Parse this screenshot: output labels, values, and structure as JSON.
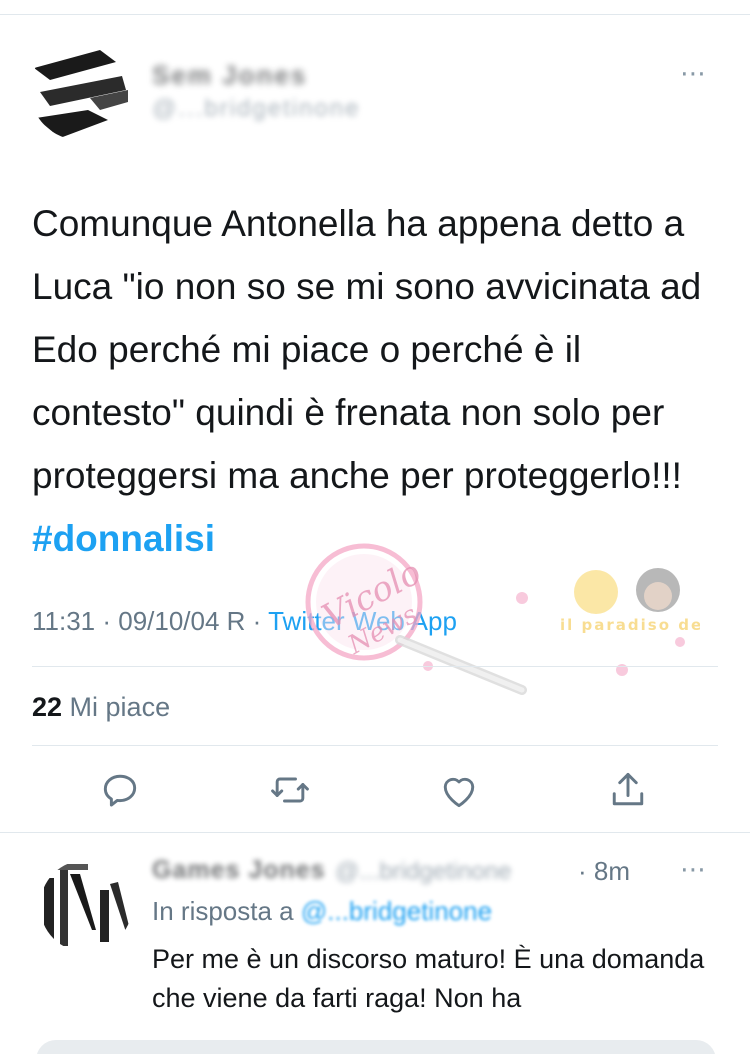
{
  "tweet": {
    "author_name": "Sem Jones",
    "author_handle": "@...bridgetinone",
    "text_main": "Comunque Antonella ha appena detto a Luca \"io non so se mi sono avvicinata ad Edo perché mi piace o perché è il contesto\" quindi è frenata non solo per proteggersi ma anche per proteggerlo!!! ",
    "hashtag": "#donnalisi",
    "timestamp": "11:31 · 09/10/04 R · ",
    "source": "Twitter Web App",
    "likes_count": "22",
    "likes_label": " Mi piace",
    "more_icon": "⋯"
  },
  "actions": [
    {
      "name": "reply-icon"
    },
    {
      "name": "retweet-icon"
    },
    {
      "name": "like-icon"
    },
    {
      "name": "share-icon"
    }
  ],
  "reply": {
    "author_name": "Games Jones",
    "author_handle": "@...bridgetinone",
    "time": "· 8m",
    "in_reply_prefix": "In risposta a ",
    "in_reply_handle": "@...bridgetinone",
    "text": "Per me è un discorso maturo! È una domanda che viene da farti raga! Non ha",
    "more_icon": "⋯"
  },
  "watermark": {
    "stamp_text": "Vicolo delle News",
    "web_text": "Il paradiso dei web"
  },
  "colors": {
    "accent": "#1da1f2",
    "secondary_text": "#657786",
    "primary_text": "#14171a",
    "divider": "#e1e8ed"
  }
}
